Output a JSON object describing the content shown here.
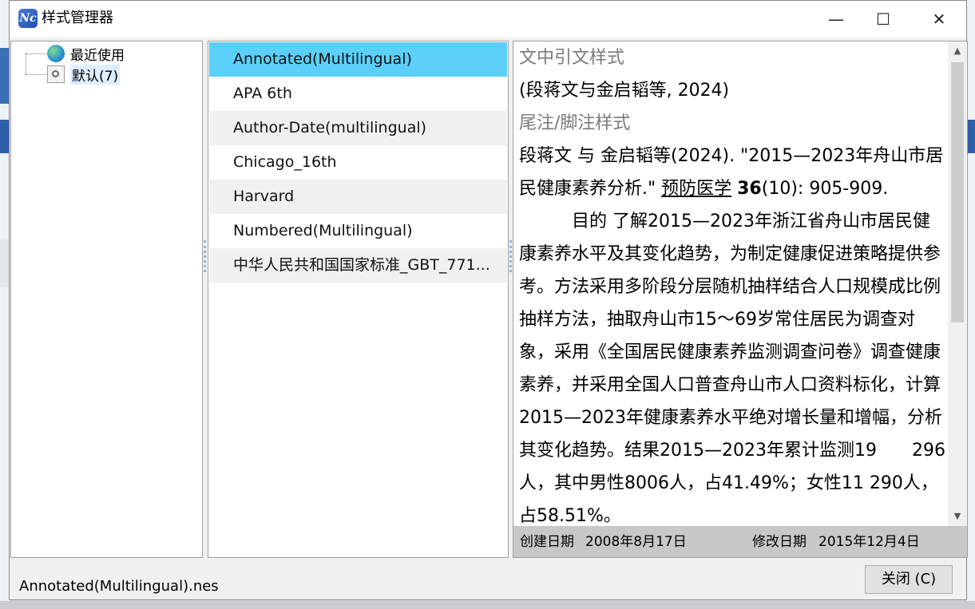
{
  "window": {
    "title": "样式管理器",
    "icon": "nc-app-icon",
    "controls": {
      "minimize": "—",
      "maximize": "☐",
      "close": "✕"
    }
  },
  "tree": {
    "items": [
      {
        "label": "最近使用",
        "icon": "globe-icon"
      },
      {
        "label": "默认(7)",
        "icon": "search-doc-icon",
        "selected": true
      }
    ]
  },
  "styles": {
    "items": [
      "Annotated(Multilingual)",
      "APA 6th",
      "Author-Date(multilingual)",
      "Chicago_16th",
      "Harvard",
      "Numbered(Multilingual)",
      "中华人民共和国国家标准_GBT_771..."
    ],
    "selected_index": 0
  },
  "preview": {
    "intext_header": "文中引文样式",
    "intext_citation": "(段蒋文与金启韬等, 2024)",
    "footnote_header": "尾注/脚注样式",
    "ref_authors_title": "段蒋文 与 金启韬等(2024). \"2015—2023年舟山市居民健康素养分析.\" ",
    "ref_journal": "预防医学",
    "ref_volume": "36",
    "ref_issue_pages": "(10): 905-909.",
    "abstract": "目的  了解2015—2023年浙江省舟山市居民健康素养水平及其变化趋势，为制定健康促进策略提供参考。方法采用多阶段分层随机抽样结合人口规模成比例抽样方法，抽取舟山市15～69岁常住居民为调查对象，采用《全国居民健康素养监测调查问卷》调查健康素养，并采用全国人口普查舟山市人口资料标化，计算2015—2023年健康素养水平绝对增长量和增幅，分析其变化趋势。结果2015—2023年累计监测19　　296人，其中男性8006人，占41.49%；女性11  290人，占58.51%。",
    "created_label": "创建日期",
    "created_value": "2008年8月17日",
    "modified_label": "修改日期",
    "modified_value": "2015年12月4日"
  },
  "footer": {
    "filename": "Annotated(Multilingual).nes",
    "close_button": "关闭 (C)"
  },
  "colors": {
    "selection": "#5bd0fb",
    "meta_bar": "#c8c8c8",
    "header_gray": "#7a7a7a"
  }
}
